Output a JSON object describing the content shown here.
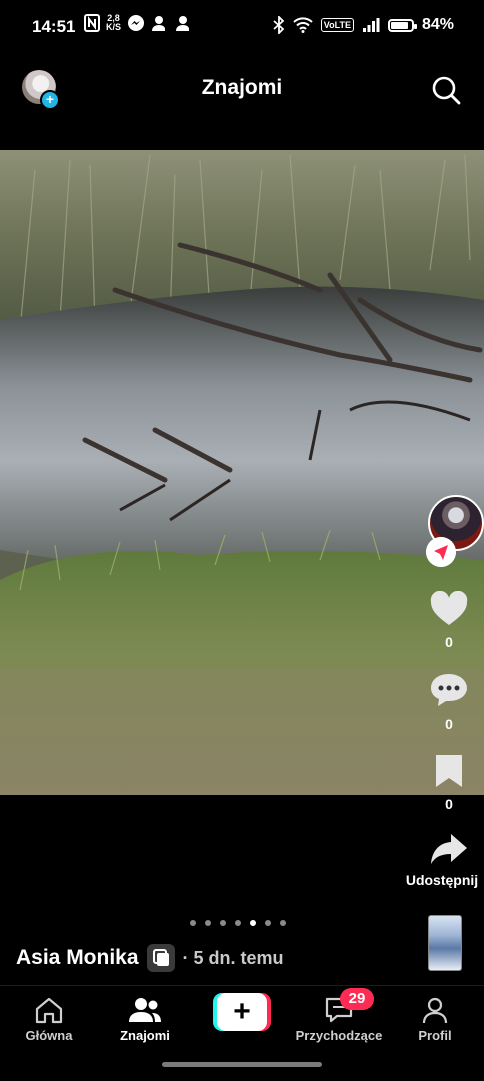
{
  "status_bar": {
    "time": "14:51",
    "net_speed_value": "2,8",
    "net_speed_unit": "K/S",
    "volte_label": "VoLTE",
    "battery_level": 0.84,
    "battery_text": "84%"
  },
  "top_bar": {
    "title": "Znajomi",
    "avatar_icon": "user-avatar-add",
    "search_icon": "search-icon"
  },
  "rail": {
    "like_count": "0",
    "comment_count": "0",
    "bookmark_count": "0",
    "share_label": "Udostępnij"
  },
  "carousel": {
    "total": 7,
    "active_index": 4
  },
  "post": {
    "author": "Asia Monika",
    "time": "· 5 dn. temu"
  },
  "bottom_nav": {
    "home_label": "Główna",
    "friends_label": "Znajomi",
    "inbox_label": "Przychodzące",
    "inbox_badge": "29",
    "profile_label": "Profil"
  },
  "colors": {
    "accent_cyan": "#25f4ee",
    "accent_red": "#fe2c55",
    "background": "#000000"
  }
}
